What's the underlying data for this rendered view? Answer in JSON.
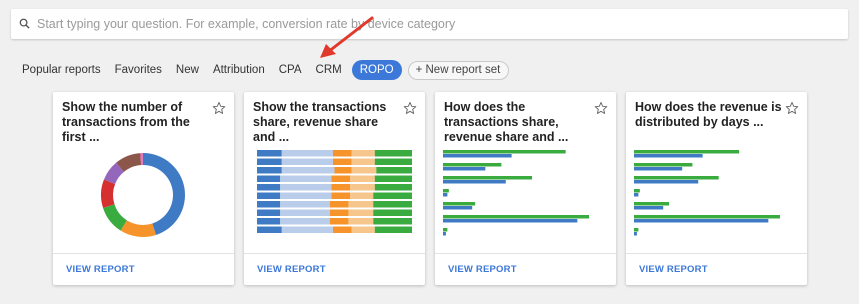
{
  "search": {
    "placeholder": "Start typing your question. For example, conversion rate by device category"
  },
  "tabs": [
    {
      "label": "Popular reports"
    },
    {
      "label": "Favorites"
    },
    {
      "label": "New"
    },
    {
      "label": "Attribution"
    },
    {
      "label": "CPA"
    },
    {
      "label": "CRM"
    },
    {
      "label": "ROPO",
      "active": true
    }
  ],
  "new_set_label": "+ New report set",
  "annotation": {
    "arrow_color": "#e0392b"
  },
  "colors": {
    "blue": "#3e7bc4",
    "light_blue": "#b9cdea",
    "orange": "#f7932b",
    "light_orange": "#f6c68c",
    "green": "#3aab3f",
    "red": "#d62f2f",
    "purple": "#9467bd",
    "brown": "#8c564b",
    "pink": "#e377c2",
    "accent": "#3c78d8"
  },
  "cards": [
    {
      "title": "Show the number of transactions from the first ...",
      "action": "VIEW REPORT"
    },
    {
      "title": "Show the transactions share, revenue share and ...",
      "action": "VIEW REPORT"
    },
    {
      "title": "How does the transactions share, revenue share and ...",
      "action": "VIEW REPORT"
    },
    {
      "title": "How does the revenue is distributed by days ...",
      "action": "VIEW REPORT"
    }
  ],
  "chart_data": [
    {
      "type": "pie",
      "values": [
        45,
        14,
        11,
        11,
        8,
        10,
        1
      ],
      "colors": [
        "#3e7bc4",
        "#f7932b",
        "#3aab3f",
        "#d62f2f",
        "#9467bd",
        "#8c564b",
        "#e377c2"
      ]
    },
    {
      "type": "bar",
      "stacked": true,
      "percent": true,
      "series_colors": [
        "#3e7bc4",
        "#b9cdea",
        "#f7932b",
        "#f6c68c",
        "#3aab3f"
      ],
      "rows": [
        [
          16,
          33,
          12,
          15,
          24
        ],
        [
          16,
          33,
          12,
          15,
          24
        ],
        [
          16,
          34,
          11,
          16,
          23
        ],
        [
          15,
          33,
          12,
          16,
          24
        ],
        [
          15,
          33,
          12,
          16,
          24
        ],
        [
          15,
          33,
          12,
          15,
          25
        ],
        [
          15,
          32,
          12,
          16,
          25
        ],
        [
          15,
          32,
          12,
          16,
          25
        ],
        [
          15,
          32,
          12,
          16,
          25
        ],
        [
          16,
          33,
          12,
          15,
          24
        ]
      ]
    },
    {
      "type": "bar",
      "orientation": "horizontal",
      "series_colors": [
        "#3aab3f",
        "#3e7bc4"
      ],
      "rows": [
        [
          84,
          47
        ],
        [
          40,
          29
        ],
        [
          61,
          43
        ],
        [
          4,
          3
        ],
        [
          22,
          20
        ],
        [
          100,
          92
        ],
        [
          3,
          2
        ]
      ]
    },
    {
      "type": "bar",
      "orientation": "horizontal",
      "series_colors": [
        "#3aab3f",
        "#3e7bc4"
      ],
      "rows": [
        [
          72,
          47
        ],
        [
          40,
          33
        ],
        [
          58,
          44
        ],
        [
          4,
          3
        ],
        [
          24,
          20
        ],
        [
          100,
          92
        ],
        [
          3,
          2
        ]
      ]
    }
  ]
}
